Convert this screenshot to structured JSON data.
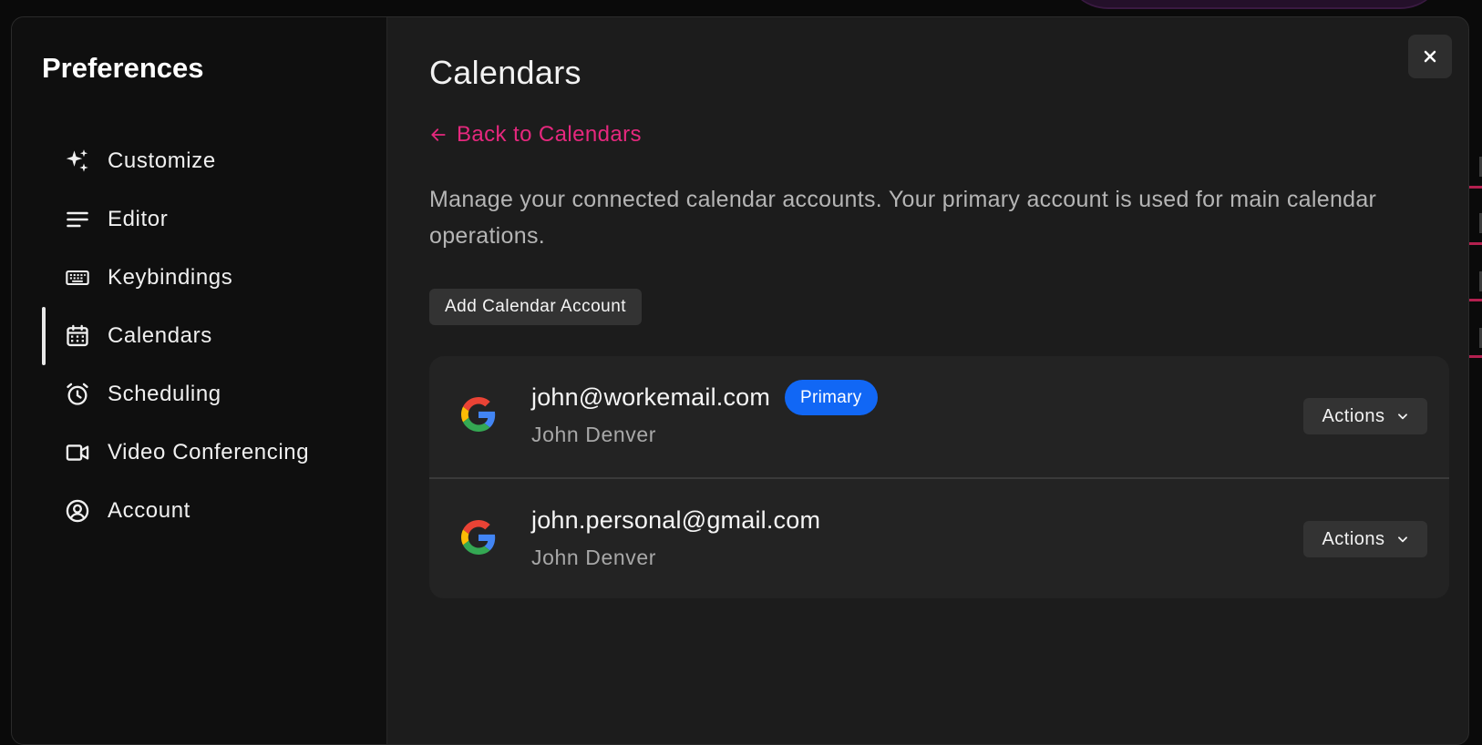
{
  "sidebar": {
    "title": "Preferences",
    "items": [
      {
        "label": "Customize",
        "icon": "sparkles-icon",
        "active": false
      },
      {
        "label": "Editor",
        "icon": "text-lines-icon",
        "active": false
      },
      {
        "label": "Keybindings",
        "icon": "keyboard-icon",
        "active": false
      },
      {
        "label": "Calendars",
        "icon": "calendar-icon",
        "active": true
      },
      {
        "label": "Scheduling",
        "icon": "alarm-clock-icon",
        "active": false
      },
      {
        "label": "Video Conferencing",
        "icon": "video-camera-icon",
        "active": false
      },
      {
        "label": "Account",
        "icon": "user-circle-icon",
        "active": false
      }
    ]
  },
  "main": {
    "title": "Calendars",
    "back_link": "Back to Calendars",
    "description": "Manage your connected calendar accounts. Your primary account is used for main calendar operations.",
    "add_button": "Add Calendar Account",
    "accounts": [
      {
        "email": "john@workemail.com",
        "name": "John Denver",
        "badge": "Primary",
        "actions": "Actions",
        "provider_icon": "google-icon"
      },
      {
        "email": "john.personal@gmail.com",
        "name": "John Denver",
        "actions": "Actions",
        "provider_icon": "google-icon"
      }
    ]
  },
  "colors": {
    "accent_link": "#e6287e",
    "primary_badge": "#1167f5",
    "modal_bg": "#1c1c1c",
    "sidebar_bg": "#0f0f0f"
  }
}
